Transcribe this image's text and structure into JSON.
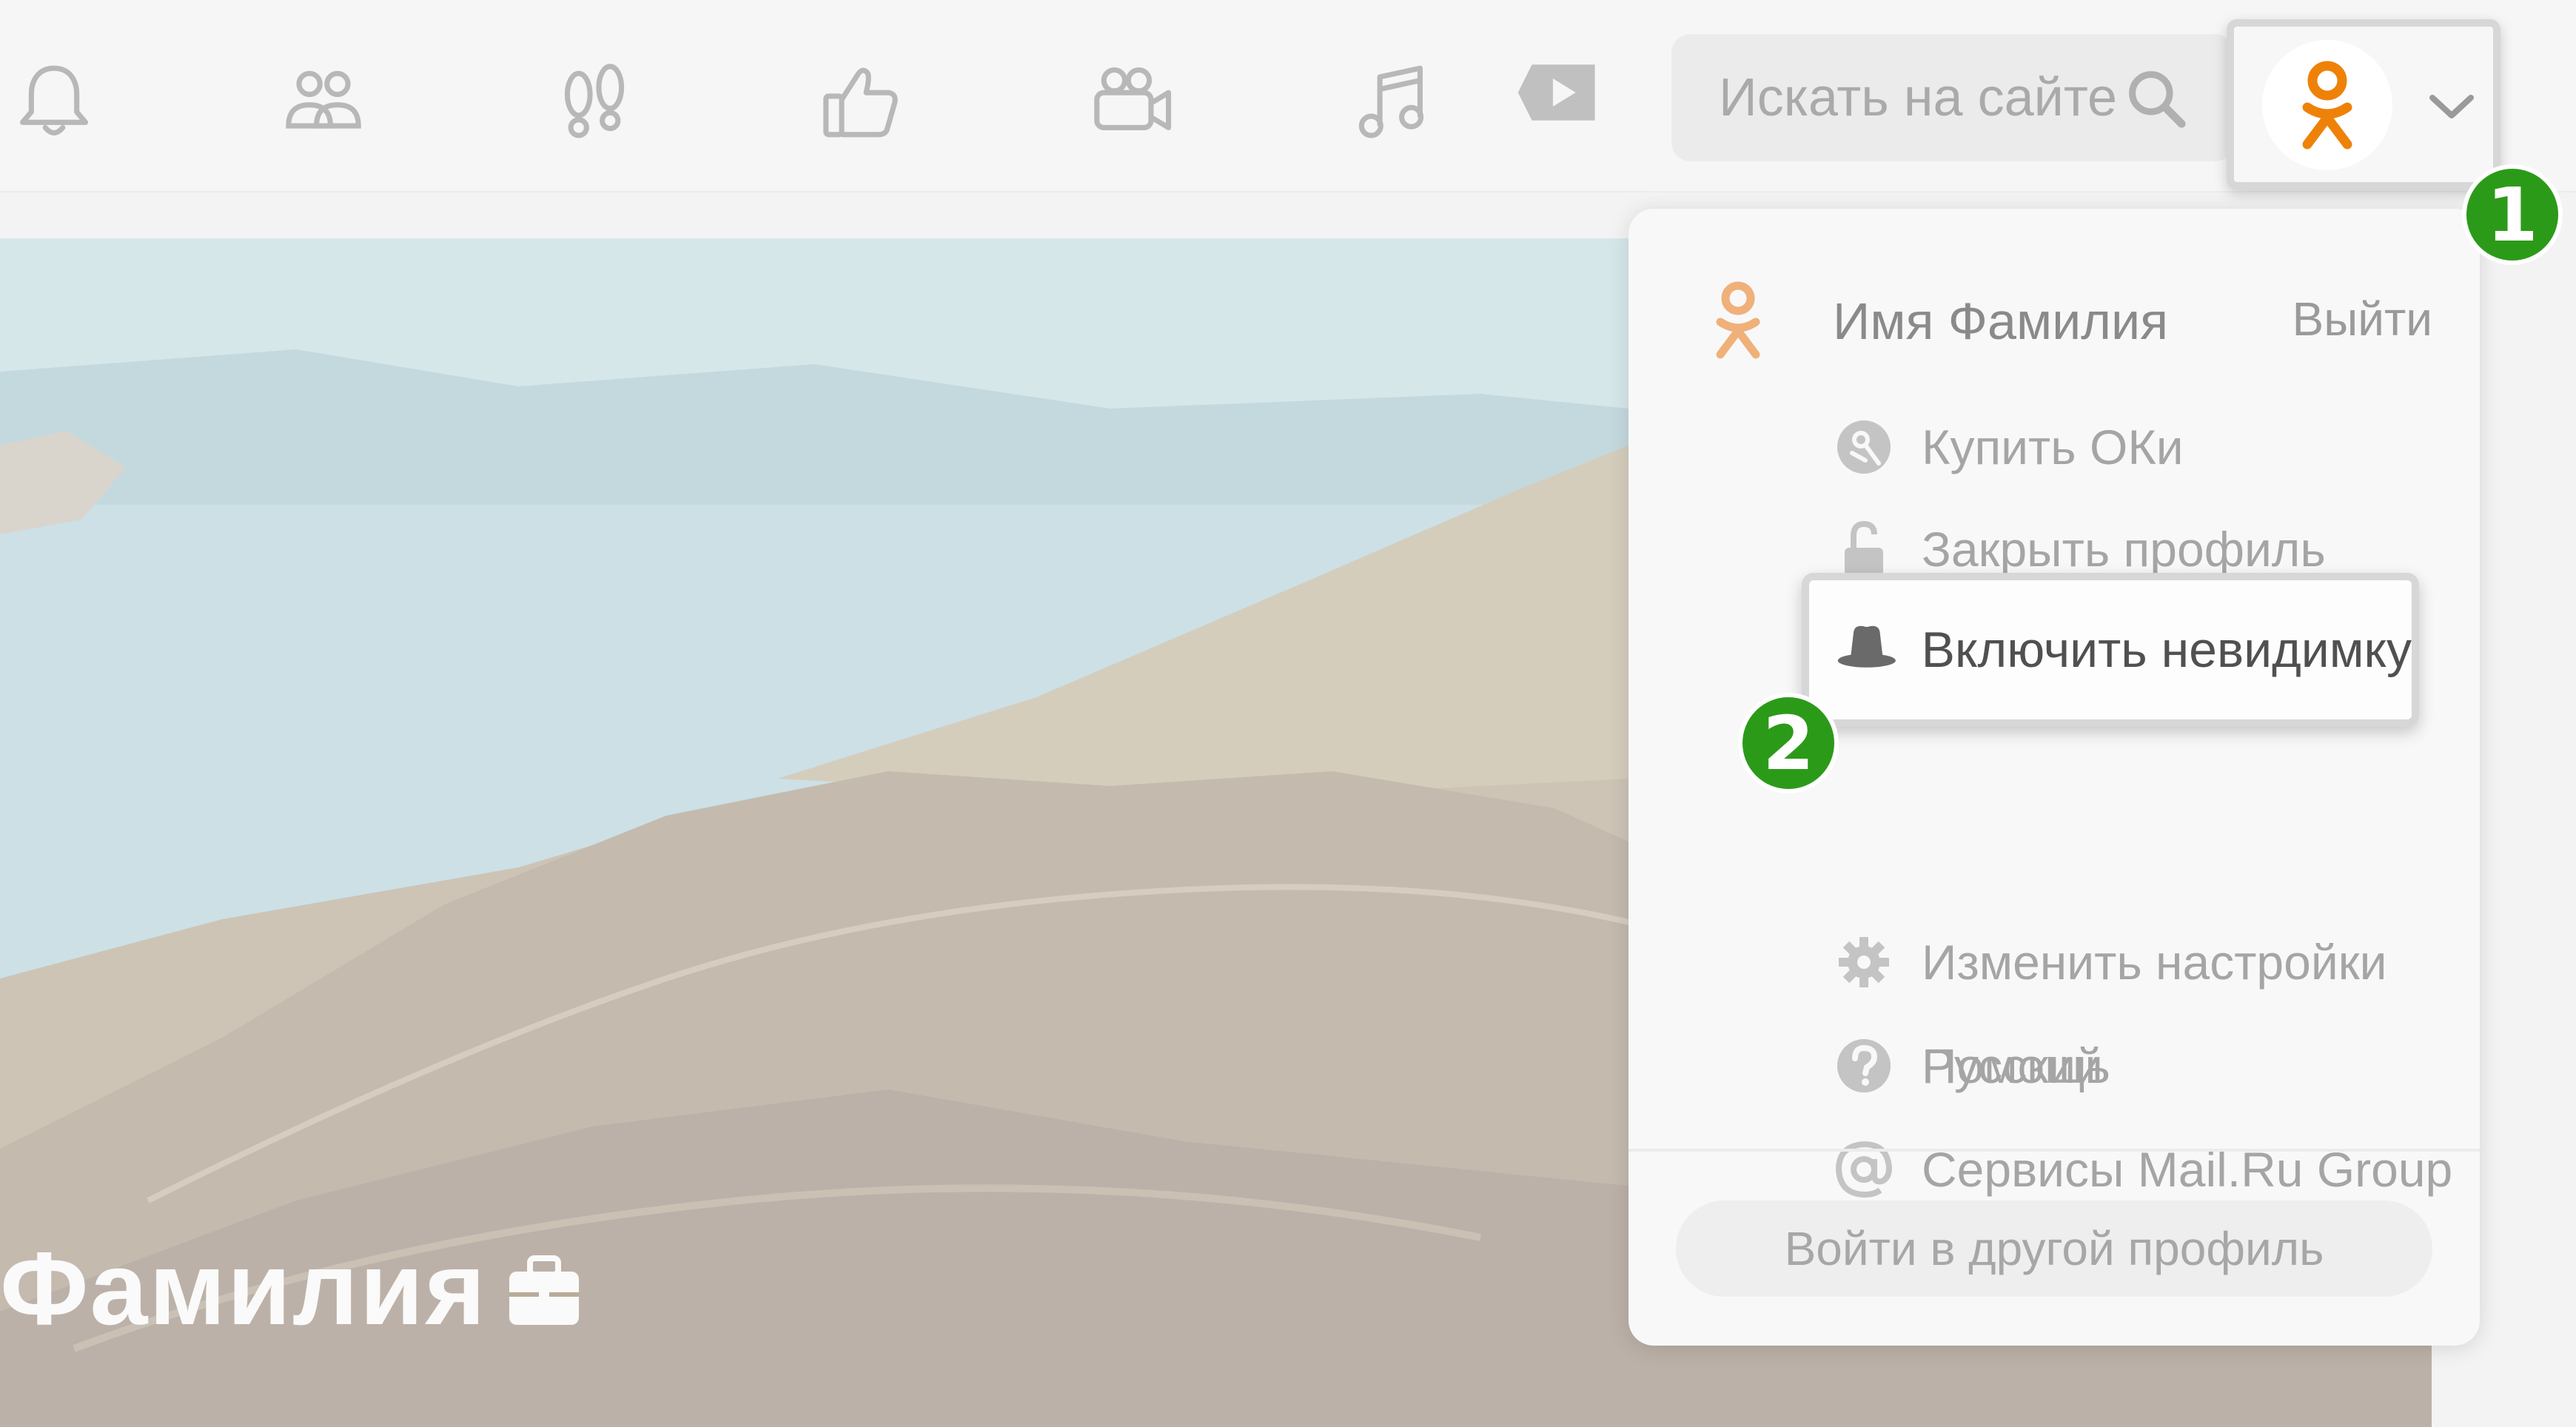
{
  "nav": {
    "items": [
      {
        "name": "notifications-icon"
      },
      {
        "name": "friends-icon"
      },
      {
        "name": "guests-icon"
      },
      {
        "name": "events-icon"
      },
      {
        "name": "video-icon"
      },
      {
        "name": "music-icon"
      },
      {
        "name": "video-player-icon"
      }
    ],
    "search_placeholder": "Искать на сайте"
  },
  "profile": {
    "name_partial": "Фамилия"
  },
  "dropdown": {
    "user_name": "Имя Фамилия",
    "logout": "Выйти",
    "items": [
      {
        "label": "Купить ОКи",
        "icon": "ok-coin-icon"
      },
      {
        "label": "Закрыть профиль",
        "icon": "lock-icon"
      },
      {
        "label": "Включить невидимку",
        "icon": "hat-icon"
      },
      {
        "label": "Изменить настройки",
        "icon": "gear-icon"
      },
      {
        "label": "Русский",
        "icon": "globe-icon"
      },
      {
        "label": "Сервисы Mail.Ru Group",
        "icon": "at-icon"
      },
      {
        "label": "Помощь",
        "icon": "help-icon"
      }
    ],
    "other_profile": "Войти в другой профиль"
  },
  "steps": {
    "one": "1",
    "two": "2"
  },
  "colors": {
    "ok_orange": "#ee8208",
    "step_green": "#2c9a19",
    "icon_gray": "#b8b8b8"
  }
}
